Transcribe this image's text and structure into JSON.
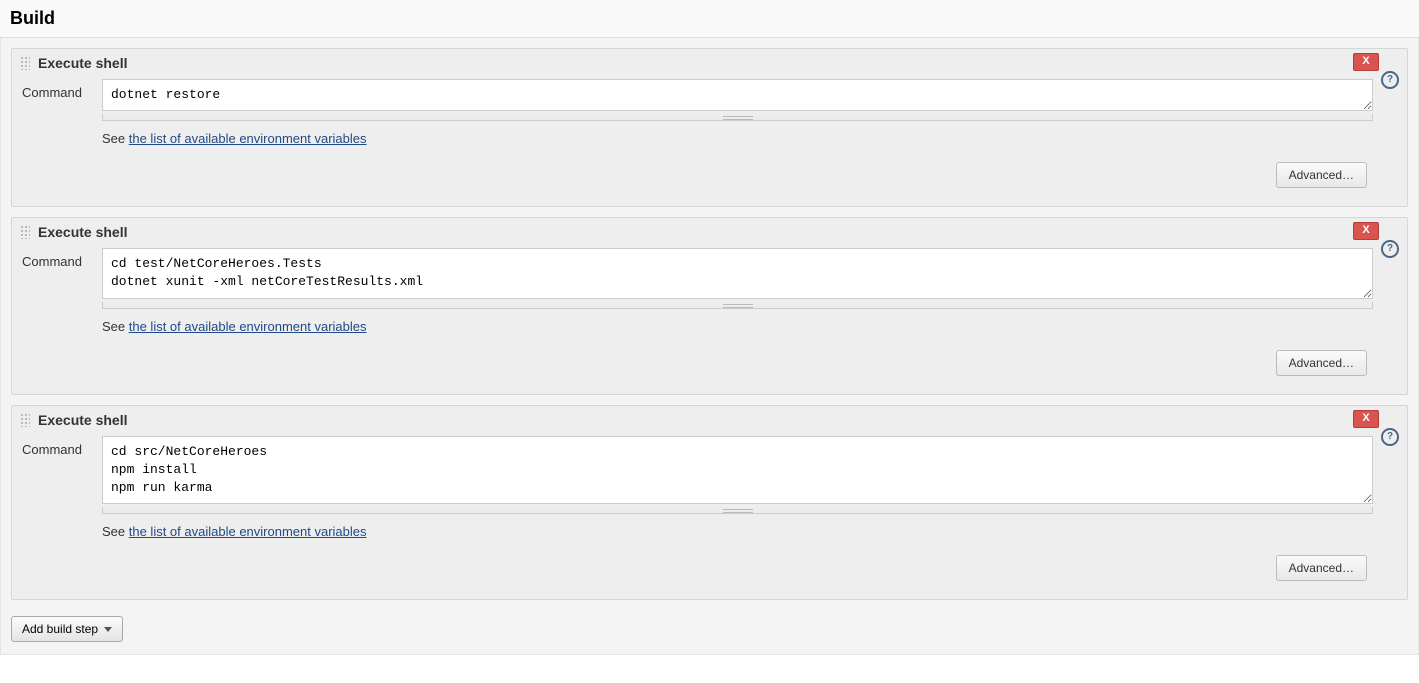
{
  "section": {
    "title": "Build"
  },
  "steps": [
    {
      "title": "Execute shell",
      "delete_label": "X",
      "command_label": "Command",
      "command_value": "dotnet restore",
      "help_prefix": "See ",
      "help_link": "the list of available environment variables",
      "advanced_label": "Advanced…"
    },
    {
      "title": "Execute shell",
      "delete_label": "X",
      "command_label": "Command",
      "command_value": "cd test/NetCoreHeroes.Tests\ndotnet xunit -xml netCoreTestResults.xml",
      "help_prefix": "See ",
      "help_link": "the list of available environment variables",
      "advanced_label": "Advanced…"
    },
    {
      "title": "Execute shell",
      "delete_label": "X",
      "command_label": "Command",
      "command_value": "cd src/NetCoreHeroes\nnpm install\nnpm run karma",
      "help_prefix": "See ",
      "help_link": "the list of available environment variables",
      "advanced_label": "Advanced…"
    }
  ],
  "add_step_label": "Add build step",
  "help_icon_char": "?"
}
